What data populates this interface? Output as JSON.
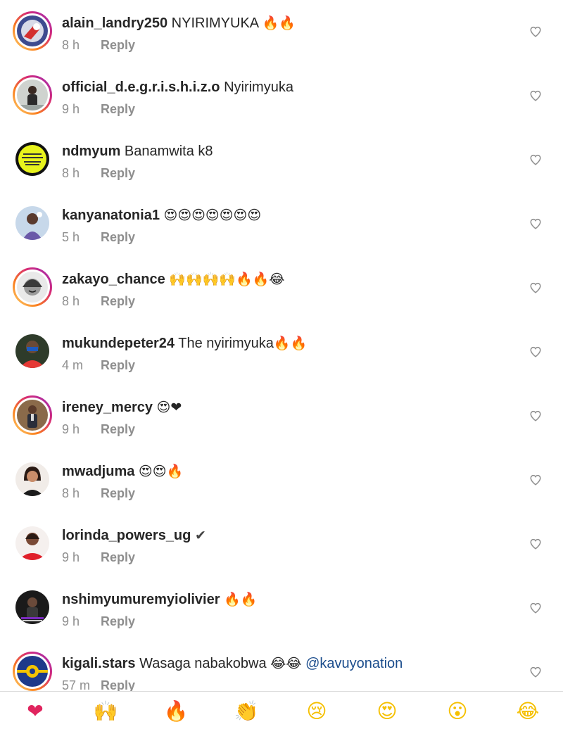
{
  "comments": [
    {
      "username": "alain_landry250",
      "text": "NYIRIMYUKA",
      "emojis": "🔥🔥",
      "time": "8 h",
      "reply": "Reply",
      "mention": ""
    },
    {
      "username": "official_d.e.g.r.i.s.h.i.z.o",
      "text": "Nyirimyuka",
      "emojis": "",
      "time": "9 h",
      "reply": "Reply",
      "mention": ""
    },
    {
      "username": "ndmyum",
      "text": "Banamwita k8",
      "emojis": "",
      "time": "8 h",
      "reply": "Reply",
      "mention": ""
    },
    {
      "username": "kanyanatonia1",
      "text": "",
      "emojis": "😍😍😍😍😍😍😍",
      "time": "5 h",
      "reply": "Reply",
      "mention": ""
    },
    {
      "username": "zakayo_chance",
      "text": "",
      "emojis": "🙌🙌🙌🙌🔥🔥😂",
      "time": "8 h",
      "reply": "Reply",
      "mention": ""
    },
    {
      "username": "mukundepeter24",
      "text": "The nyirimyuka",
      "emojis": "🔥🔥",
      "time": "4 m",
      "reply": "Reply",
      "mention": ""
    },
    {
      "username": "ireney_mercy",
      "text": "",
      "emojis": "😍❤",
      "time": "9 h",
      "reply": "Reply",
      "mention": ""
    },
    {
      "username": "mwadjuma",
      "text": "",
      "emojis": "😍😍🔥",
      "time": "8 h",
      "reply": "Reply",
      "mention": ""
    },
    {
      "username": "lorinda_powers_ug",
      "text": "",
      "emojis": "✔",
      "time": "9 h",
      "reply": "Reply",
      "mention": ""
    },
    {
      "username": "nshimyumuremyiolivier",
      "text": "",
      "emojis": "🔥🔥",
      "time": "9 h",
      "reply": "Reply",
      "mention": ""
    },
    {
      "username": "kigali.stars",
      "text": "Wasaga nabakobwa",
      "emojis": "😂😂",
      "time": "57 m",
      "reply": "Reply",
      "mention": "@kavuyonation"
    }
  ],
  "emoji_bar": [
    {
      "emoji": "❤",
      "icon": "red-heart-icon",
      "color": "#e0245e"
    },
    {
      "emoji": "🙌",
      "icon": "raising-hands-icon",
      "color": "#f5b342"
    },
    {
      "emoji": "🔥",
      "icon": "fire-icon",
      "color": "#f4511e"
    },
    {
      "emoji": "👏",
      "icon": "clapping-hands-icon",
      "color": "#f5b342"
    },
    {
      "emoji": "😢",
      "icon": "crying-face-icon",
      "color": "#f5c000"
    },
    {
      "emoji": "😍",
      "icon": "heart-eyes-face-icon",
      "color": "#f5c000"
    },
    {
      "emoji": "😮",
      "icon": "surprised-face-icon",
      "color": "#f5c000"
    },
    {
      "emoji": "😂",
      "icon": "tears-of-joy-face-icon",
      "color": "#f5c000"
    }
  ],
  "colors": {
    "username": "#262626",
    "meta": "#8e8e8e",
    "mention": "#1a4c8c",
    "story_ring": "#d62976"
  }
}
